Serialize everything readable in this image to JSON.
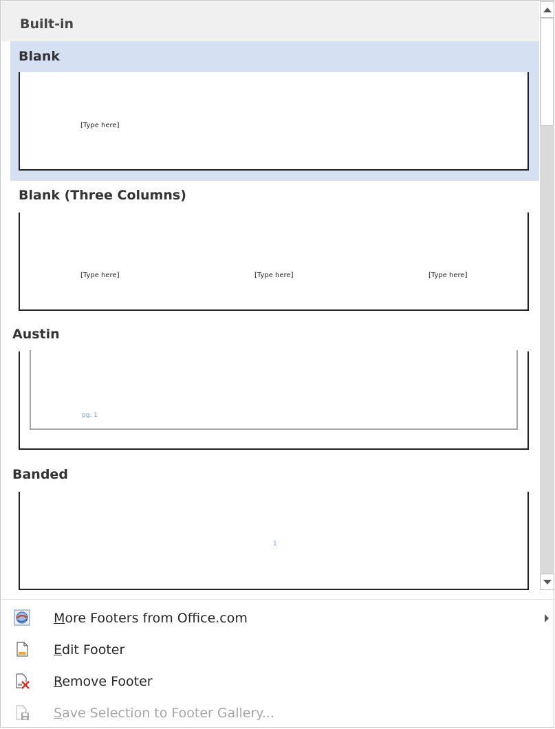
{
  "gallery": {
    "section_label": "Built-in",
    "items": [
      {
        "title": "Blank",
        "placeholders": [
          "[Type here]"
        ],
        "selected": true
      },
      {
        "title": "Blank (Three Columns)",
        "placeholders": [
          "[Type here]",
          "[Type here]",
          "[Type here]"
        ]
      },
      {
        "title": "Austin",
        "placeholders": [
          "pg. 1"
        ]
      },
      {
        "title": "Banded",
        "placeholders": [
          "1"
        ]
      }
    ]
  },
  "menu": {
    "items": [
      {
        "accel": "M",
        "rest": "ore Footers from Office.com",
        "icon": "office-globe-icon",
        "has_submenu": true,
        "enabled": true
      },
      {
        "accel": "E",
        "rest": "dit Footer",
        "icon": "edit-footer-icon",
        "enabled": true
      },
      {
        "accel": "R",
        "rest": "emove Footer",
        "icon": "remove-footer-icon",
        "enabled": true
      },
      {
        "accel": "S",
        "rest": "ave Selection to Footer Gallery...",
        "icon": "save-footer-icon",
        "enabled": false
      }
    ]
  },
  "colors": {
    "selection": "#d5e1f2",
    "header_bg": "#f0f0f0",
    "placeholder_blue": "#6d9ed6"
  }
}
